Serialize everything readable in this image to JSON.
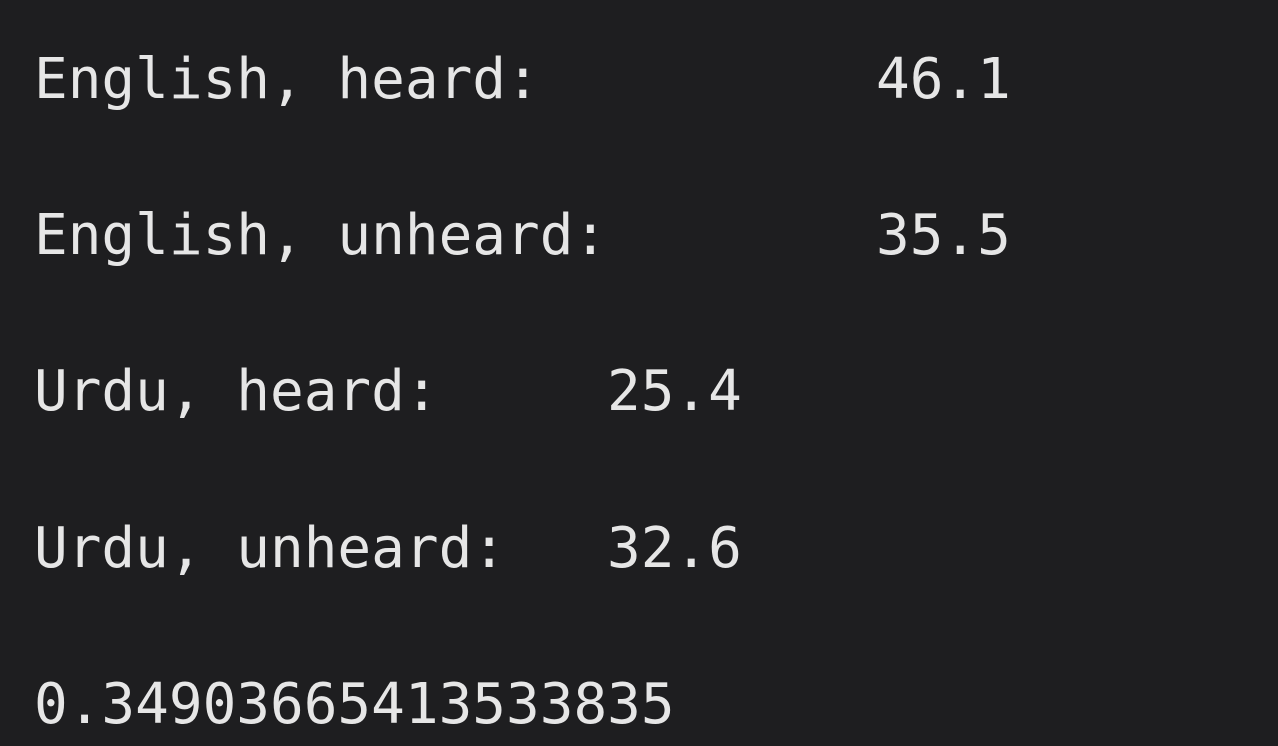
{
  "output": {
    "lines": [
      {
        "label": "English, heard:",
        "value": "46.1"
      },
      {
        "label": "English, unheard:",
        "value": "35.5"
      },
      {
        "label": "Urdu, heard:",
        "value": "25.4"
      },
      {
        "label": "Urdu, unheard:",
        "value": "32.6"
      }
    ],
    "result": "0.34903665413533835"
  },
  "colors": {
    "background": "#1e1e20",
    "text": "#e6e6e6"
  }
}
